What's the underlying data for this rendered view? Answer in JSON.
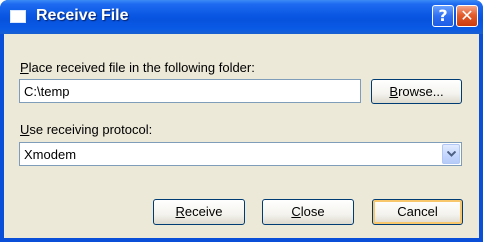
{
  "window": {
    "title": "Receive File",
    "help_glyph": "?",
    "close_glyph": "✕"
  },
  "folder": {
    "label_accel": "P",
    "label_rest": "lace received file in the following folder:",
    "value": "C:\\temp",
    "browse_accel": "B",
    "browse_rest": "rowse..."
  },
  "protocol": {
    "label_accel": "U",
    "label_rest": "se receiving protocol:",
    "selected": "Xmodem"
  },
  "buttons": {
    "receive_accel": "R",
    "receive_rest": "eceive",
    "close_accel": "C",
    "close_rest": "lose",
    "cancel_label": "Cancel"
  },
  "colors": {
    "titlebar": "#0a57e3",
    "client": "#ece9d8",
    "default_button_highlight": "#f9c76b"
  },
  "icons": [
    "window-icon",
    "help-icon",
    "close-icon",
    "chevron-down-icon"
  ]
}
